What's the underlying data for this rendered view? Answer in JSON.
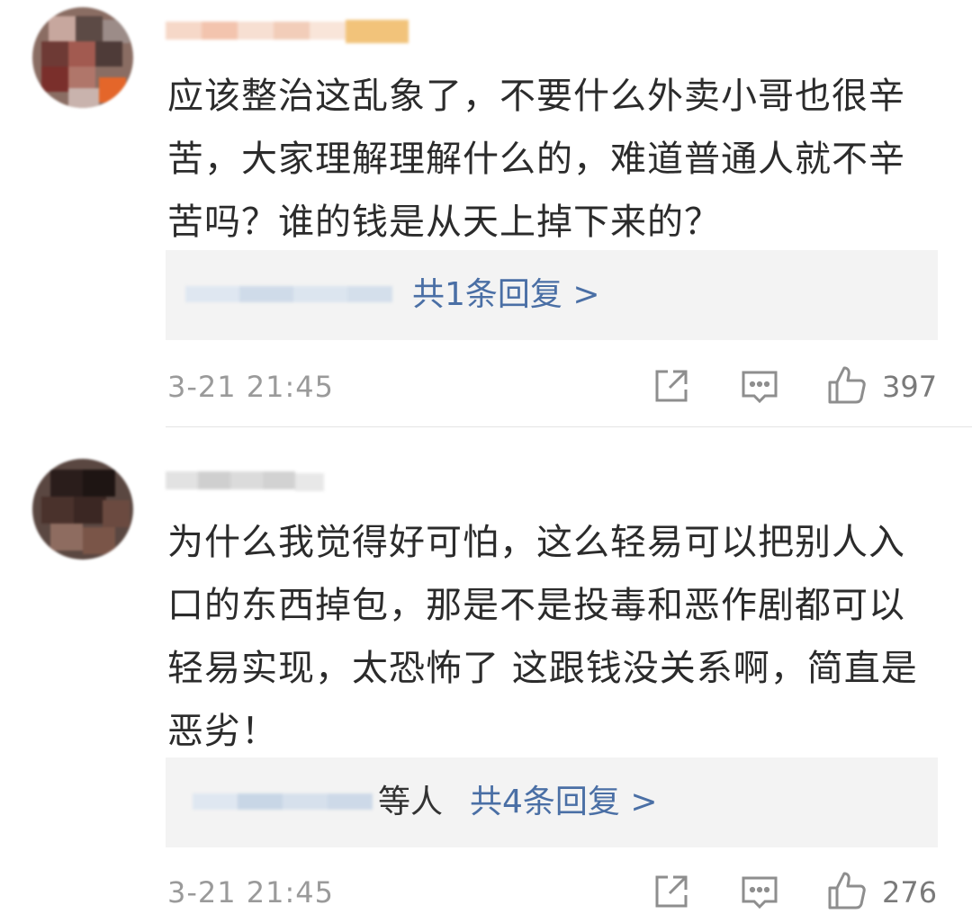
{
  "comments": [
    {
      "text": "应该整治这乱象了，不要什么外卖小哥也很辛苦，大家理解理解什么的，难道普通人就不辛苦吗？谁的钱是从天上掉下来的？",
      "reply_prefix": "",
      "reply_link": "共1条回复 >",
      "time": "3-21 21:45",
      "like_count": "397"
    },
    {
      "text": "为什么我觉得好可怕，这么轻易可以把别人入口的东西掉包，那是不是投毒和恶作剧都可以轻易实现，太恐怖了 这跟钱没关系啊，简直是恶劣！",
      "reply_prefix": "等人",
      "reply_link": "共4条回复 >",
      "time": "3-21 21:45",
      "like_count": "276"
    }
  ],
  "icons": {
    "share": "share-icon",
    "comment": "comment-icon",
    "like": "thumbs-up-icon"
  },
  "colors": {
    "link": "#4a6fa5",
    "meta": "#9a9a9a",
    "reply_bg": "#f3f3f3"
  }
}
